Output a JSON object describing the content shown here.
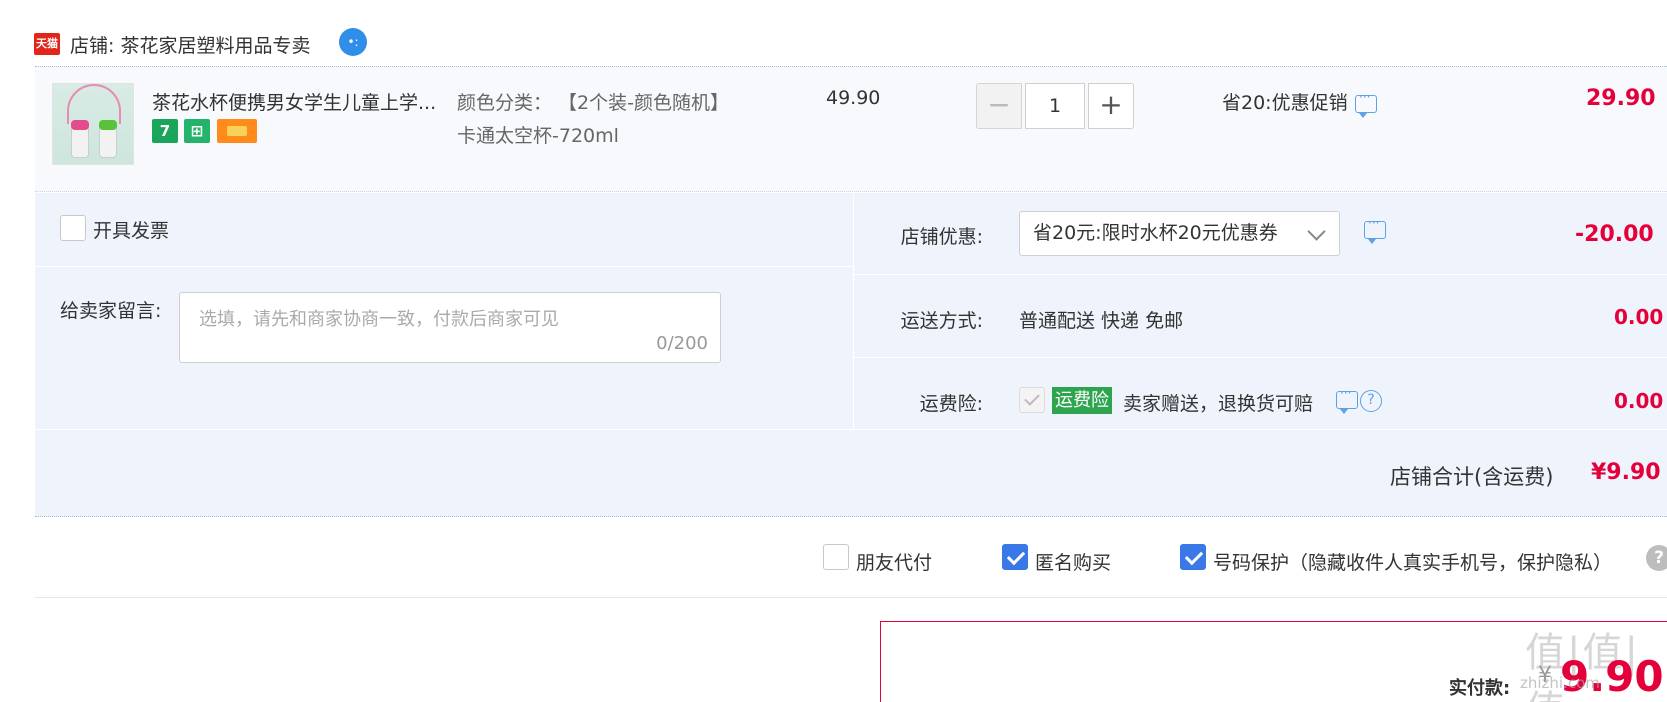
{
  "shop": {
    "logo_text": "天猫",
    "label": "店铺: 茶花家居塑料用品专卖",
    "ww_icon": "aliwangwang-icon"
  },
  "item": {
    "title": "茶花水杯便携男女学生儿童上学...",
    "badges": [
      "7",
      "bag-badge-icon",
      "card-badge-icon"
    ],
    "sku_line1": "颜色分类：  【2个装-颜色随机】",
    "sku_line2": "卡通太空杯-720ml",
    "unit_price": "49.90",
    "quantity": "1",
    "qty_minus": "−",
    "qty_plus": "+",
    "promo": "省20:优惠促销",
    "total": "29.90"
  },
  "invoice": {
    "label": "开具发票",
    "checked": false
  },
  "note": {
    "label": "给卖家留言:",
    "placeholder": "选填，请先和商家协商一致，付款后商家可见",
    "counter": "0/200"
  },
  "shop_discount": {
    "label": "店铺优惠:",
    "selected": "省20元:限时水杯20元优惠券",
    "value": "-20.00"
  },
  "shipping": {
    "label": "运送方式:",
    "method": "普通配送 快递 免邮",
    "value": "0.00"
  },
  "insurance": {
    "label": "运费险:",
    "tag": "运费险",
    "desc": "卖家赠送，退换货可赔",
    "value": "0.00",
    "help": "?"
  },
  "subtotal": {
    "label": "店铺合计(含运费)",
    "value": "¥9.90"
  },
  "options": [
    {
      "label": "朋友代付",
      "checked": false
    },
    {
      "label": "匿名购买",
      "checked": true
    },
    {
      "label": "号码保护（隐藏收件人真实手机号，保护隐私）",
      "checked": true
    }
  ],
  "options_help": "?",
  "payment": {
    "label": "实付款:",
    "currency": "¥",
    "value": "9.90",
    "watermark": "值|值|值",
    "watermark_sub": "zhizhi.com"
  },
  "colors": {
    "accent_red": "#e4003a",
    "checkbox_blue": "#3b78e7",
    "panel_bg": "#eff4fc",
    "insurance_green": "#2ea44f"
  }
}
